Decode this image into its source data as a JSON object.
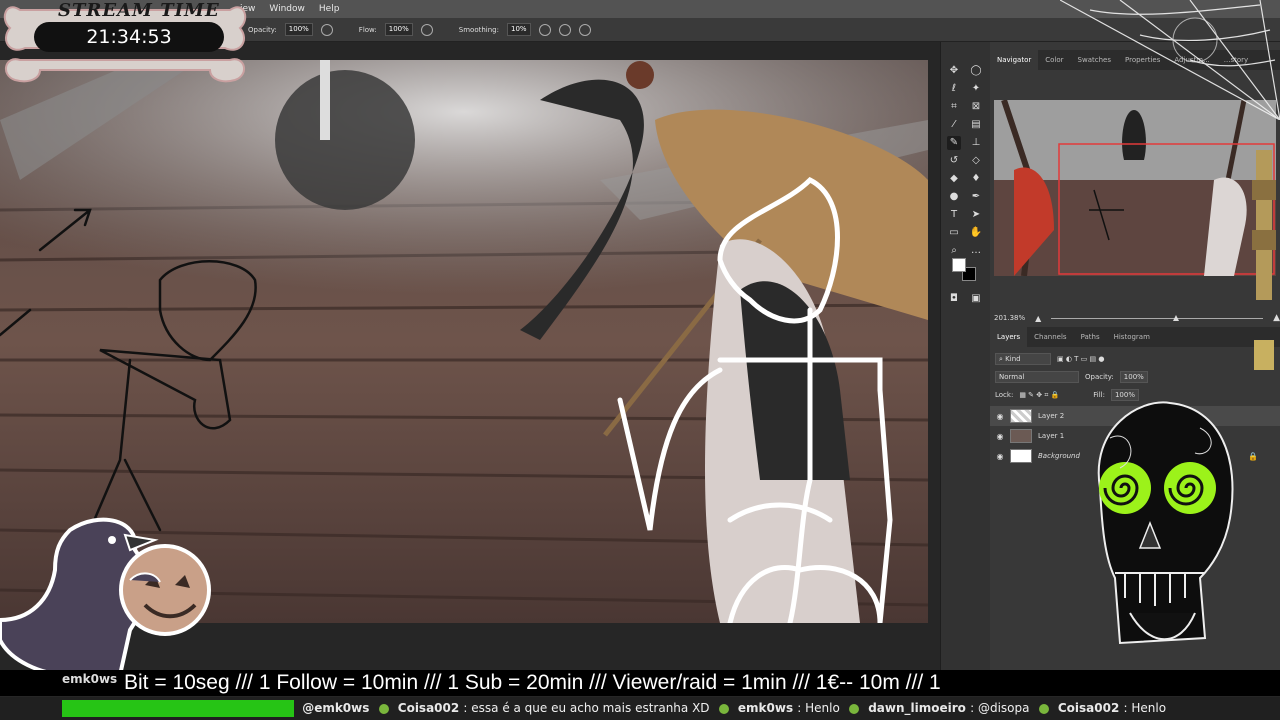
{
  "overlay": {
    "title": "STREAM TIME",
    "timer": "21:34:53",
    "ticker": "Bit = 10seg  /// 1 Follow = 10min /// 1 Sub = 20min /// Viewer/raid = 1min ///  1€-- 10m /// 1",
    "ticker_user": "emk0ws"
  },
  "menu": {
    "items": [
      "iew",
      "Window",
      "Help"
    ]
  },
  "options": {
    "opacity_label": "Opacity:",
    "opacity_value": "100%",
    "flow_label": "Flow:",
    "flow_value": "100%",
    "smoothing_label": "Smoothing:",
    "smoothing_value": "10%"
  },
  "panels": {
    "top_tabs": [
      "Navigator",
      "Color",
      "Swatches",
      "Properties",
      "Adjustm...",
      "...story"
    ],
    "zoom": "201.38%",
    "layer_tabs": [
      "Layers",
      "Channels",
      "Paths",
      "Histogram"
    ],
    "kind": "Kind",
    "blend_mode": "Normal",
    "opacity_label": "Opacity:",
    "opacity_value": "100%",
    "lock_label": "Lock:",
    "fill_label": "Fill:",
    "fill_value": "100%",
    "layers": [
      "Layer 2",
      "Layer 1",
      "Background"
    ]
  },
  "chat": [
    {
      "name": "@emk0ws",
      "msg": ""
    },
    {
      "name": "Coisa002",
      "msg": ": essa é a que eu acho mais estranha XD"
    },
    {
      "name": "emk0ws",
      "msg": ": Henlo"
    },
    {
      "name": "dawn_limoeiro",
      "msg": ": @disopa"
    },
    {
      "name": "Coisa002",
      "msg": ": Henlo"
    }
  ],
  "colors": {
    "ps_dark": "#383838",
    "chat_green": "#26c415",
    "swirl_green": "#9cf21a"
  }
}
